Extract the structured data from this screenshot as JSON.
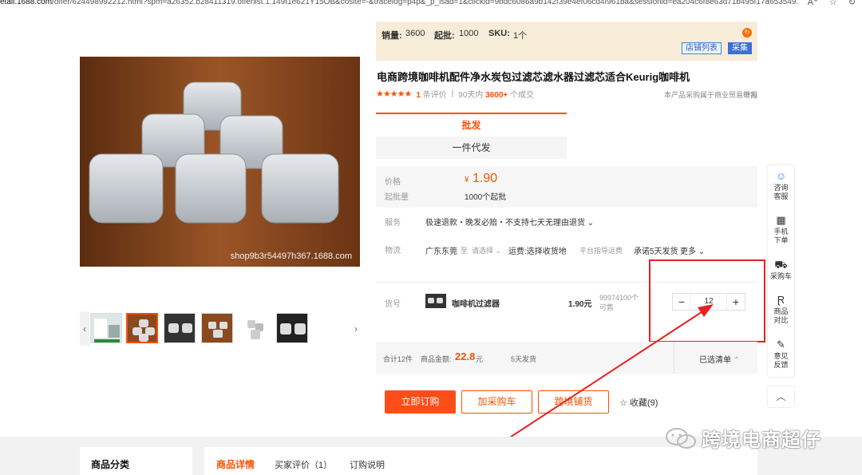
{
  "address_bar": {
    "host": "etail.1688.com",
    "path": "/offer/624498992212.html?spm=a26352.b28411319.offerlist.1.149f1e621Y15OB&cosite=-&tracelog=p4p&_p_isad=1&clickid=9bdc6086a9b142f39e4ef06cd4f961ba&sessionid=ea204c6f8e63d71b495f17a653549..."
  },
  "info_strip": {
    "sales_label": "销量:",
    "sales_value": "3600",
    "moq_label": "起批:",
    "moq_value": "1000",
    "sku_label": "SKU:",
    "sku_value": "1个",
    "store_list_button": "店铺列表",
    "collect_button": "采集"
  },
  "product": {
    "title": "电商跨境咖啡机配件净水炭包过滤芯滤水器过滤芯适合Keurig咖啡机",
    "image_watermark": "shop9b3r54497h367.1688.com",
    "review_count": "1",
    "review_suffix": "条评价",
    "ninety_days_label": "90天内",
    "ninety_days_value": "3600+",
    "ninety_days_suffix": "个成交",
    "purchase_note": "本产品采购属于商业贸易行为",
    "report_label": "举报"
  },
  "tabs": {
    "wholesale": "批发",
    "dropship": "一件代发"
  },
  "price_box": {
    "price_label": "价格",
    "currency": "¥",
    "price_value": "1.90",
    "moq_label": "起批量",
    "moq_value": "1000个起批"
  },
  "service": {
    "label": "服务",
    "value": "极速退款・晚发必赔・不支持七天无理由退货"
  },
  "logistics": {
    "label": "物流",
    "origin": "广东东莞",
    "to": "至",
    "select": "请选择",
    "shipping_fee": "运费:选择收货地",
    "platform_guide": "平台指导运费",
    "promise": "承诺5天发货",
    "more": "更多"
  },
  "sku": {
    "label": "货号",
    "name": "咖啡机过滤器",
    "price": "1.90元",
    "stock_line1": "99974100个",
    "stock_line2": "可售",
    "quantity": "12",
    "minus": "−",
    "plus": "+"
  },
  "summary": {
    "total_count": "合计12件",
    "amount_label": "商品金额:",
    "amount_value": "22.8",
    "amount_unit": "元",
    "ship_days": "5天发货",
    "selected_list": "已选清单"
  },
  "actions": {
    "buy_now": "立即订购",
    "add_cart": "加采购车",
    "cross_border": "跨境铺货",
    "favorite": "收藏(9)"
  },
  "sidebar": {
    "consult_line1": "咨询",
    "consult_line2": "客服",
    "mobile_line1": "手机",
    "mobile_line2": "下单",
    "cart": "采购车",
    "compare_line1": "商品",
    "compare_line2": "对比",
    "feedback_line1": "意见",
    "feedback_line2": "反馈"
  },
  "bottom": {
    "category_title": "商品分类",
    "tab_details": "商品详情",
    "tab_reviews": "买家评价（1）",
    "tab_order_info": "订购说明"
  },
  "watermark_brand": "跨境电商超仔",
  "colors": {
    "accent": "#ff5000",
    "annotation_red": "#e82020",
    "strip_bg": "#f7ecd8",
    "link_blue": "#2d62c4"
  }
}
